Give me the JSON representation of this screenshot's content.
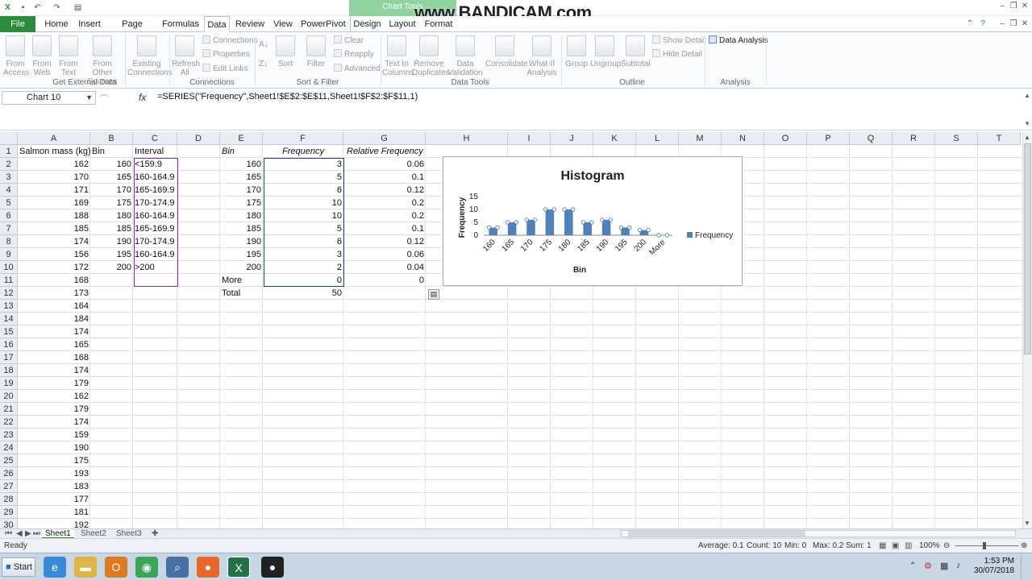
{
  "titlebar": {
    "chart_tools": "Chart Tools"
  },
  "watermark": "www.BANDICAM.com",
  "tabs": [
    {
      "label": "File",
      "left": 0
    },
    {
      "label": "Home"
    },
    {
      "label": "Insert"
    },
    {
      "label": "Page Layout"
    },
    {
      "label": "Formulas"
    },
    {
      "label": "Data"
    },
    {
      "label": "Review"
    },
    {
      "label": "View"
    },
    {
      "label": "PowerPivot"
    },
    {
      "label": "Design"
    },
    {
      "label": "Layout"
    },
    {
      "label": "Format"
    }
  ],
  "ribbon": {
    "from_access": "From Access",
    "from_web": "From Web",
    "from_text": "From Text",
    "from_other": "From Other Sources",
    "existing": "Existing Connections",
    "refresh": "Refresh All",
    "connections": "Connections",
    "properties": "Properties",
    "edit_links": "Edit Links",
    "sort": "Sort",
    "filter": "Filter",
    "clear": "Clear",
    "reapply": "Reapply",
    "advanced": "Advanced",
    "text_to_columns": "Text to Columns",
    "remove_dup": "Remove Duplicates",
    "data_validation": "Data Validation",
    "consolidate": "Consolidate",
    "what_if": "What-If Analysis",
    "group": "Group",
    "ungroup": "Ungroup",
    "subtotal": "Subtotal",
    "show_detail": "Show Detail",
    "hide_detail": "Hide Detail",
    "data_analysis": "Data Analysis",
    "groups": {
      "external": "Get External Data",
      "connections": "Connections",
      "sortfilter": "Sort & Filter",
      "datatools": "Data Tools",
      "outline": "Outline",
      "analysis": "Analysis"
    }
  },
  "formula_bar": {
    "name_box": "Chart 10",
    "formula": "=SERIES(\"Frequency\",Sheet1!$E$2:$E$11,Sheet1!$F$2:$F$11,1)"
  },
  "columns": [
    "A",
    "B",
    "C",
    "D",
    "E",
    "F",
    "G",
    "H",
    "I",
    "J",
    "K",
    "L",
    "M",
    "N",
    "O",
    "P",
    "Q",
    "R",
    "S",
    "T"
  ],
  "row_numbers": [
    "1",
    "2",
    "3",
    "4",
    "5",
    "6",
    "7",
    "8",
    "9",
    "10",
    "11",
    "12",
    "13",
    "14",
    "15",
    "16",
    "17",
    "18",
    "19",
    "20",
    "21",
    "22",
    "23",
    "24",
    "25",
    "26",
    "27",
    "28",
    "29",
    "30"
  ],
  "headers": {
    "A": "Salmon mass (kg)",
    "B": "Bin",
    "C": "Interval",
    "E": "Bin",
    "F": "Frequency",
    "G": "Relative Frequency"
  },
  "colA": [
    "162",
    "170",
    "171",
    "169",
    "188",
    "185",
    "174",
    "156",
    "172",
    "168",
    "173",
    "164",
    "184",
    "174",
    "165",
    "168",
    "174",
    "179",
    "162",
    "179",
    "174",
    "159",
    "190",
    "175",
    "193",
    "183",
    "177",
    "181",
    "192"
  ],
  "colB": [
    "160",
    "165",
    "170",
    "175",
    "180",
    "185",
    "190",
    "195",
    "200"
  ],
  "colC": [
    "<159.9",
    "160-164.9",
    "165-169.9",
    "170-174.9",
    "160-164.9",
    "165-169.9",
    "170-174.9",
    "160-164.9",
    ">200"
  ],
  "colE": [
    "160",
    "165",
    "170",
    "175",
    "180",
    "185",
    "190",
    "195",
    "200",
    "More",
    "Total"
  ],
  "colF": [
    "3",
    "5",
    "6",
    "10",
    "10",
    "5",
    "6",
    "3",
    "2",
    "0",
    "50"
  ],
  "colG": [
    "0.06",
    "0.1",
    "0.12",
    "0.2",
    "0.2",
    "0.1",
    "0.12",
    "0.06",
    "0.04",
    "0"
  ],
  "chart_data": {
    "type": "bar",
    "title": "Histogram",
    "xlabel": "Bin",
    "ylabel": "Frequency",
    "categories": [
      "160",
      "165",
      "170",
      "175",
      "180",
      "185",
      "190",
      "195",
      "200",
      "More"
    ],
    "series": [
      {
        "name": "Frequency",
        "values": [
          3,
          5,
          6,
          10,
          10,
          5,
          6,
          3,
          2,
          0
        ]
      }
    ],
    "yticks": [
      "0",
      "5",
      "10",
      "15"
    ],
    "ylim": [
      0,
      15
    ],
    "legend": "right",
    "color": "#4f81bd"
  },
  "sheet_tabs": [
    "Sheet1",
    "Sheet2",
    "Sheet3"
  ],
  "status": {
    "mode": "Ready",
    "average": "Average: 0.1",
    "count": "Count: 10",
    "min": "Min: 0",
    "max": "Max: 0.2",
    "sum": "Sum: 1",
    "zoom": "100%"
  },
  "taskbar": {
    "start": "Start",
    "time": "1:53 PM",
    "date": "30/07/2018"
  }
}
